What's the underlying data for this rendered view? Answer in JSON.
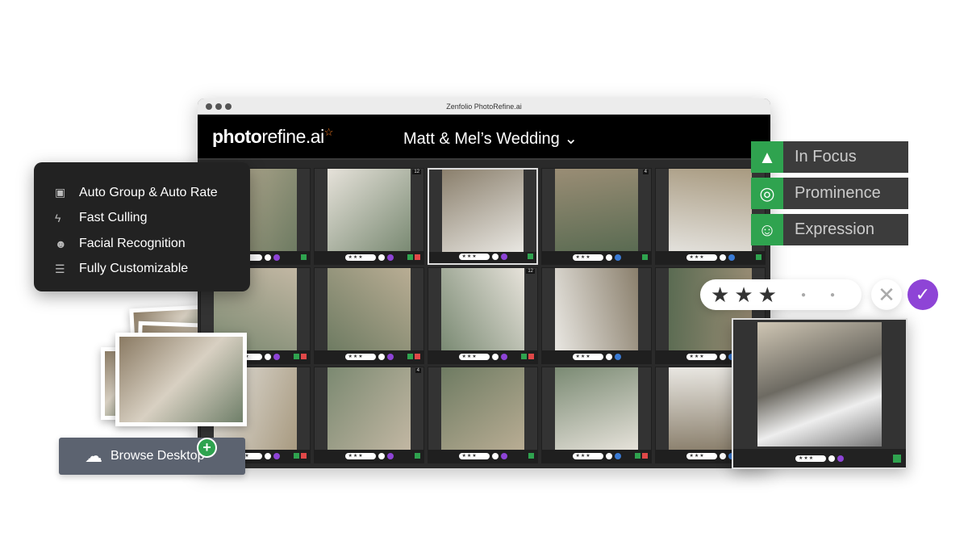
{
  "window": {
    "title": "Zenfolio PhotoRefine.ai"
  },
  "app": {
    "logo_bold": "photo",
    "logo_rest": "refine.ai",
    "album": "Matt & Mel’s Wedding"
  },
  "colors": {
    "accent": "#8e44d6",
    "green": "#2fa34f",
    "red": "#e04848",
    "blue": "#3a7bd5",
    "logo_star": "#f47a20"
  },
  "cells": [
    {
      "stars": "★★★",
      "check": "purple",
      "flags": [
        "green"
      ]
    },
    {
      "stars": "★★★",
      "check": "purple",
      "flags": [
        "green",
        "red"
      ],
      "count": "12"
    },
    {
      "stars": "★★★",
      "check": "purple",
      "flags": [
        "green"
      ],
      "selected": true
    },
    {
      "stars": "★★★",
      "check": "blue",
      "flags": [
        "green"
      ],
      "count": "4"
    },
    {
      "stars": "★★★",
      "check": "blue",
      "flags": [
        "green"
      ]
    },
    {
      "stars": "★★★",
      "check": "purple",
      "flags": [
        "green",
        "red"
      ]
    },
    {
      "stars": "★★★",
      "check": "purple",
      "flags": [
        "green",
        "red"
      ]
    },
    {
      "stars": "★★★",
      "check": "purple",
      "flags": [
        "green",
        "red"
      ],
      "count": "12"
    },
    {
      "stars": "★★★",
      "check": "blue",
      "flags": []
    },
    {
      "stars": "★★★",
      "check": "blue",
      "flags": []
    },
    {
      "stars": "★★★",
      "check": "purple",
      "flags": [
        "green",
        "red"
      ]
    },
    {
      "stars": "★★★",
      "check": "purple",
      "flags": [
        "green"
      ],
      "count": "4"
    },
    {
      "stars": "★★★",
      "check": "purple",
      "flags": [
        "green"
      ]
    },
    {
      "stars": "★★★",
      "check": "blue",
      "flags": [
        "green",
        "red"
      ]
    },
    {
      "stars": "★★★",
      "check": "blue",
      "flags": [
        "green"
      ]
    }
  ],
  "features": [
    {
      "icon": "image-stack-icon",
      "label": "Auto Group & Auto Rate"
    },
    {
      "icon": "lightning-icon",
      "label": "Fast Culling"
    },
    {
      "icon": "smiley-icon",
      "label": "Facial Recognition"
    },
    {
      "icon": "sliders-icon",
      "label": "Fully Customizable"
    }
  ],
  "metrics": [
    {
      "icon": "triangle-icon",
      "label": "In Focus"
    },
    {
      "icon": "target-icon",
      "label": "Prominence"
    },
    {
      "icon": "smiley-icon",
      "label": "Expression"
    }
  ],
  "rating": {
    "stars": 3,
    "max": 5
  },
  "preview": {
    "stars": "★★★"
  },
  "browse": {
    "label": "Browse Desktop"
  }
}
